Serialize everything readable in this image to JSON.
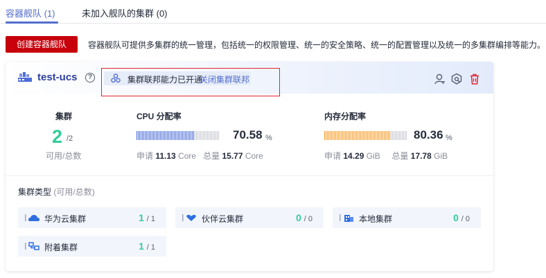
{
  "tabs": [
    {
      "label": "容器舰队 (1)",
      "active": true
    },
    {
      "label": "未加入舰队的集群 (0)",
      "active": false
    }
  ],
  "create_button": "创建容器舰队",
  "description": "容器舰队可提供多集群的统一管理，包括统一的权限管理、统一的安全策略、统一的配置管理以及统一的多集群编排等能力。",
  "fleet": {
    "name": "test-ucs",
    "help": "?",
    "federation_status": "集群联邦能力已开通",
    "federation_action": "关闭集群联邦",
    "header_icons": [
      "user-permission-icon",
      "policy-settings-icon",
      "delete-icon"
    ],
    "clusters": {
      "title": "集群",
      "available": "2",
      "total": "/2",
      "label": "可用/总数"
    },
    "cpu": {
      "title": "CPU 分配率",
      "percent": "70.58",
      "unit": "%",
      "fill": 0.7058,
      "request_label": "申请",
      "request_value": "11.13",
      "request_unit": "Core",
      "total_label": "总量",
      "total_value": "15.77",
      "total_unit": "Core"
    },
    "memory": {
      "title": "内存分配率",
      "percent": "80.36",
      "unit": "%",
      "fill": 0.8036,
      "request_label": "申请",
      "request_value": "14.29",
      "request_unit": "GiB",
      "total_label": "总量",
      "total_value": "17.78",
      "total_unit": "GiB"
    },
    "types_label": "集群类型",
    "types_sub": "(可用/总数)",
    "types": [
      {
        "name": "华为云集群",
        "icon": "cloud-icon",
        "available": "1",
        "total": "/ 1"
      },
      {
        "name": "伙伴云集群",
        "icon": "partner-heart-icon",
        "available": "0",
        "total": "/ 0"
      },
      {
        "name": "本地集群",
        "icon": "building-icon",
        "available": "0",
        "total": "/ 0"
      },
      {
        "name": "附着集群",
        "icon": "attached-network-icon",
        "available": "1",
        "total": "/ 1"
      }
    ]
  },
  "colors": {
    "accent": "#526ecc",
    "brand_red": "#c7000b",
    "green": "#33cc99",
    "cpu_bar": "#4e6ed6",
    "memory_bar": "#f59a23",
    "bar_empty": "#c7c9d1",
    "annotation_box": "#e0242f"
  }
}
